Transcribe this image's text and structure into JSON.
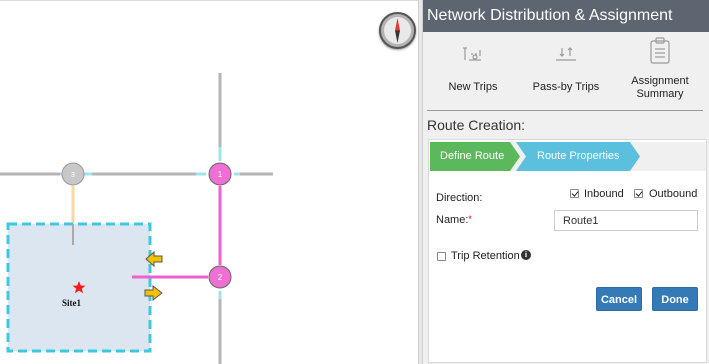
{
  "panel": {
    "title": "Network Distribution & Assignment",
    "tools": [
      {
        "label": "New Trips",
        "icon": "new-trips-icon"
      },
      {
        "label": "Pass-by Trips",
        "icon": "pass-by-trips-icon"
      },
      {
        "label": "Assignment Summary",
        "icon": "clipboard-icon"
      }
    ],
    "section_title": "Route Creation:",
    "steps": {
      "define_route": "Define Route",
      "route_properties": "Route Properties"
    },
    "form": {
      "direction_label": "Direction:",
      "inbound_label": "Inbound",
      "inbound_checked": true,
      "outbound_label": "Outbound",
      "outbound_checked": true,
      "name_label": "Name:",
      "name_required_mark": "*",
      "name_value": "Route1",
      "trip_retention_label": "Trip Retention",
      "trip_retention_checked": false
    },
    "buttons": {
      "cancel": "Cancel",
      "done": "Done"
    }
  },
  "map": {
    "site_label": "Site1",
    "nodes": [
      {
        "label": "1",
        "color": "#ef6fd5"
      },
      {
        "label": "2",
        "color": "#ef6fd5"
      },
      {
        "label": "3",
        "color": "#c8c8c8"
      }
    ],
    "colors": {
      "road": "#b5b5b5",
      "route": "#ef5fd1",
      "site_border": "#3cc9e0",
      "site_fill": "#dce6f0",
      "arrow": "#f2c200"
    }
  }
}
